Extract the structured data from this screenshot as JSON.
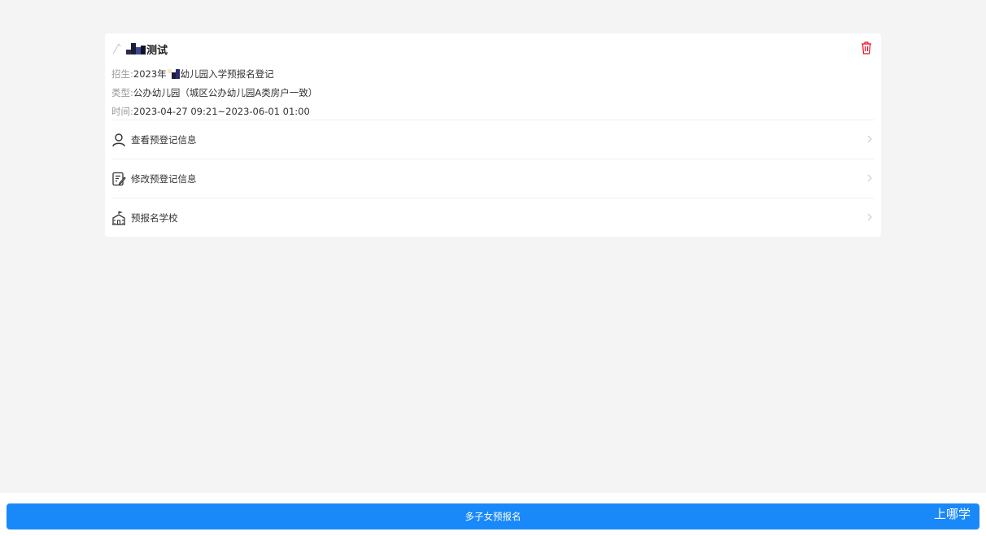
{
  "card": {
    "child_name": "测试",
    "enroll_label": "招生:",
    "enroll_prefix": "2023年",
    "enroll_suffix": "幼儿园入学预报名登记",
    "type_label": "类型:",
    "type_value": "公办幼儿园（城区公办幼儿园A类房户一致）",
    "time_label": "时间:",
    "time_value": "2023-04-27 09:21~2023-06-01 01:00"
  },
  "menu": {
    "items": [
      {
        "label": "查看预登记信息",
        "icon": "user-icon"
      },
      {
        "label": "修改预登记信息",
        "icon": "edit-document-icon"
      },
      {
        "label": "预报名学校",
        "icon": "school-building-icon"
      }
    ]
  },
  "footer": {
    "button_label": "多子女预报名",
    "watermark": "上哪学"
  },
  "colors": {
    "primary": "#1989fa",
    "danger": "#ee0a24",
    "background": "#f4f4f4"
  }
}
